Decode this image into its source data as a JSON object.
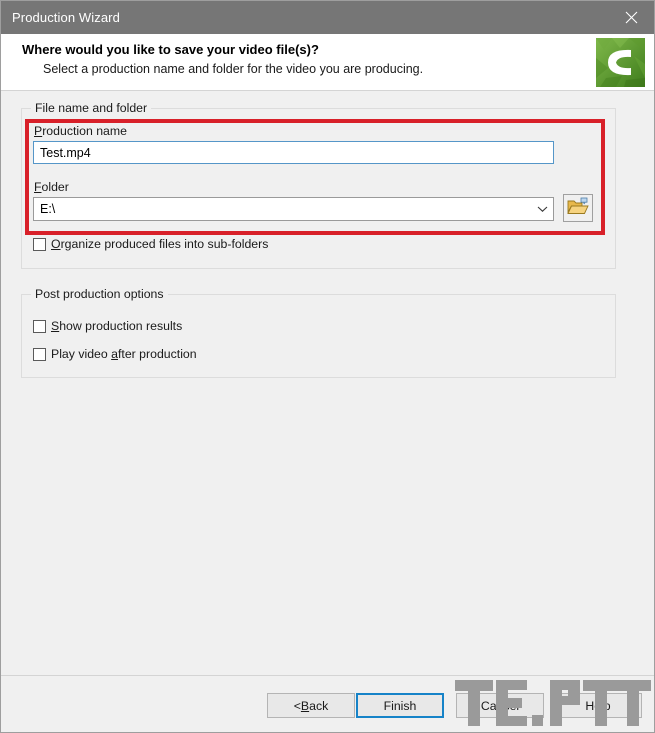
{
  "window": {
    "title": "Production Wizard",
    "close_icon": "close-icon"
  },
  "header": {
    "title": "Where would you like to save your video file(s)?",
    "subtitle": "Select a production name and folder for the video you are producing.",
    "logo_icon": "camtasia-logo-icon",
    "logo_color": "#5a9e2f"
  },
  "file_group": {
    "legend": "File name and folder",
    "production_name": {
      "label_prefix": "",
      "label_accel": "P",
      "label_rest": "roduction name",
      "value": "Test.mp4",
      "placeholder": ""
    },
    "folder": {
      "label_accel": "F",
      "label_rest": "older",
      "value": "E:\\",
      "dropdown_icon": "chevron-down-icon",
      "browse_icon": "open-folder-icon"
    },
    "organize_checkbox": {
      "accel": "O",
      "rest": "rganize produced files into sub-folders",
      "checked": false
    }
  },
  "post_production_group": {
    "legend": "Post production options",
    "show_results_checkbox": {
      "accel": "S",
      "rest": "how production results",
      "checked": false
    },
    "play_video_checkbox": {
      "prefix": "Play video ",
      "accel": "a",
      "rest": "fter production",
      "checked": false
    }
  },
  "footer": {
    "back": {
      "prefix": "< ",
      "accel": "B",
      "rest": "ack"
    },
    "finish": {
      "label": "Finish",
      "focused": true
    },
    "cancel": {
      "label": "Cancel"
    },
    "help": {
      "label": "Help"
    }
  },
  "watermark": {
    "text": "TE.PTT",
    "color": "#9a9a9a"
  },
  "colors": {
    "titlebar": "#767676",
    "body": "#f0f0f0",
    "highlight_red": "#d82029",
    "focus_blue": "#1683c8",
    "input_border_blue": "#5596c8"
  }
}
